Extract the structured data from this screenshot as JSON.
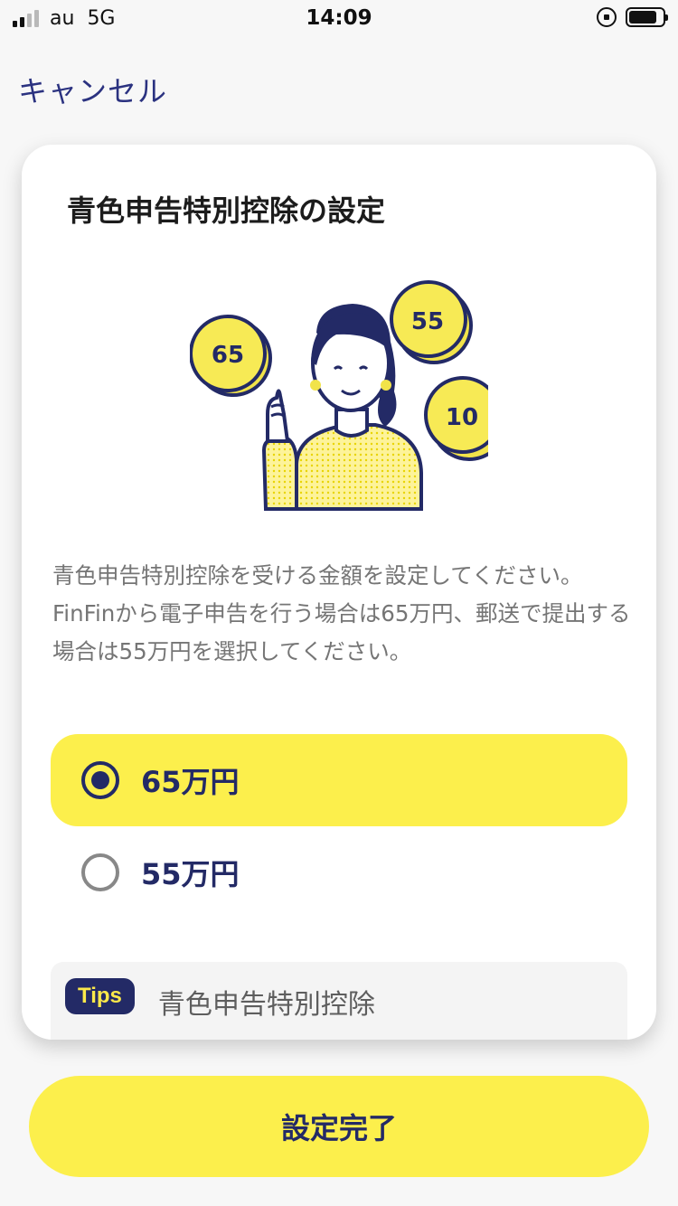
{
  "status_bar": {
    "carrier": "au",
    "network": "5G",
    "time": "14:09",
    "signal_strength": 2,
    "icons": [
      "rotation-lock-icon",
      "battery-icon"
    ]
  },
  "nav": {
    "cancel_label": "キャンセル"
  },
  "card": {
    "title": "青色申告特別控除の設定",
    "illustration": {
      "coin_labels": [
        "65",
        "55",
        "10"
      ]
    },
    "description": {
      "line1": "青色申告特別控除を受ける金額を設定してください。",
      "line2": "FinFinから電子申告を行う場合は65万円、郵送で提出する場合は55万円を選択してください。"
    },
    "options": [
      {
        "label": "65万円",
        "selected": true
      },
      {
        "label": "55万円",
        "selected": false
      }
    ],
    "tips": {
      "badge": "Tips",
      "text": "青色申告特別控除"
    }
  },
  "footer": {
    "submit_label": "設定完了"
  },
  "colors": {
    "accent_yellow": "#fcef4c",
    "navy": "#232a66",
    "link": "#2b3280",
    "background": "#f7f7f7"
  }
}
